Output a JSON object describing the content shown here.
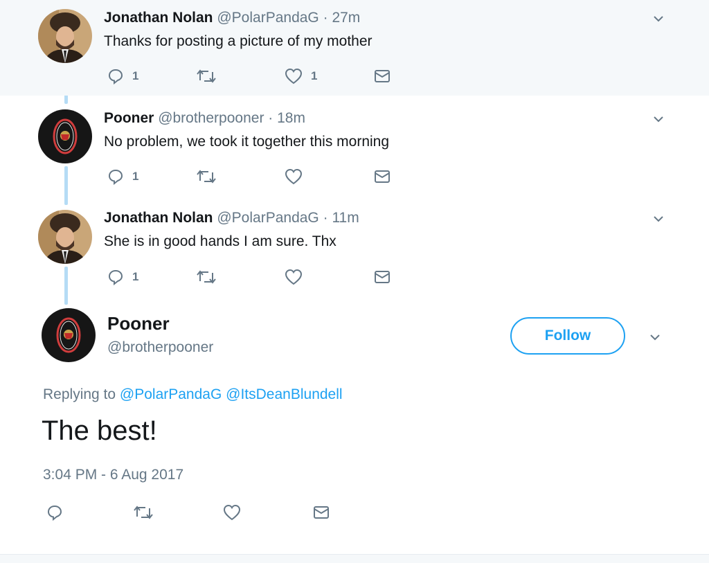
{
  "thread": [
    {
      "name": "Jonathan Nolan",
      "handle": "@PolarPandaG",
      "time": "27m",
      "text": "Thanks for posting a picture of my mother",
      "reply_count": "1",
      "retweet_count": "",
      "like_count": "1",
      "avatar": "fur-hat-man-avatar"
    },
    {
      "name": "Pooner",
      "handle": "@brotherpooner",
      "time": "18m",
      "text": "No problem, we took it together this morning",
      "reply_count": "1",
      "retweet_count": "",
      "like_count": "",
      "avatar": "senators-logo-avatar"
    },
    {
      "name": "Jonathan Nolan",
      "handle": "@PolarPandaG",
      "time": "11m",
      "text": "She is in good hands I am sure. Thx",
      "reply_count": "1",
      "retweet_count": "",
      "like_count": "",
      "avatar": "fur-hat-man-avatar"
    }
  ],
  "main_tweet": {
    "name": "Pooner",
    "handle": "@brotherpooner",
    "follow_label": "Follow",
    "replying_prefix": "Replying to",
    "reply_targets": [
      "@PolarPandaG",
      "@ItsDeanBlundell"
    ],
    "text": "The best!",
    "timestamp": "3:04 PM - 6 Aug 2017"
  },
  "colors": {
    "accent": "#1da1f2",
    "secondary_text": "#657786",
    "thread_line": "#b5dcf5",
    "highlight_bg": "#f5f8fa"
  }
}
